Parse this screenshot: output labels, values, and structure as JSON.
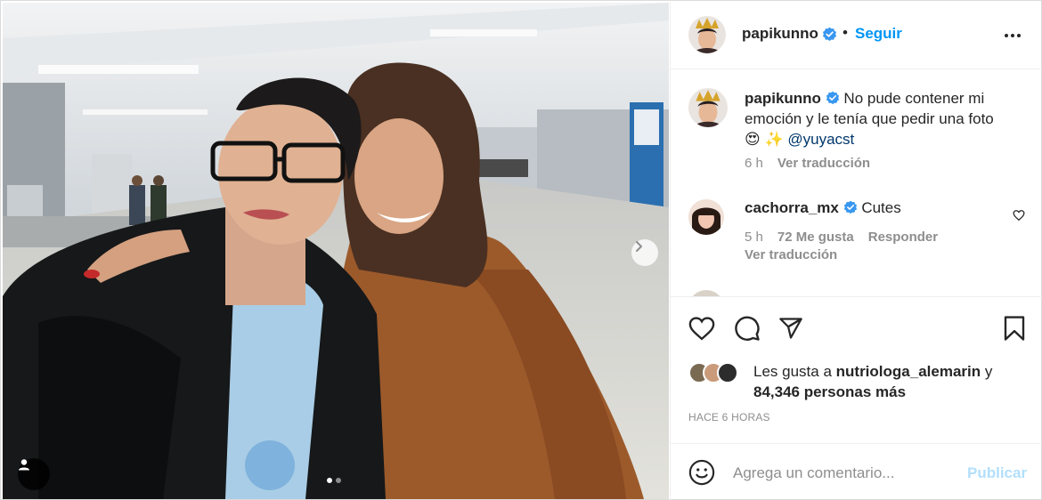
{
  "post": {
    "username": "papikunno",
    "separator": "•",
    "follow_label": "Seguir",
    "more_icon": "more-horizontal-icon",
    "carousel": {
      "current": 1,
      "total": 2
    }
  },
  "caption": {
    "username": "papikunno",
    "text": "No pude contener mi emoción y le tenía que pedir una foto",
    "emojis": "😍 ✨",
    "mention": "@yuyacst",
    "time": "6 h",
    "translate": "Ver traducción"
  },
  "comments": [
    {
      "username": "cachorra_mx",
      "text": "Cutes",
      "time": "5 h",
      "likes": "72 Me gusta",
      "reply": "Responder",
      "translate": "Ver traducción"
    }
  ],
  "likes": {
    "prefix": "Les gusta a",
    "liker": "nutriologa_alemarin",
    "joiner": "y",
    "others": "84,346 personas más"
  },
  "timestamp": "HACE 6 HORAS",
  "comment_box": {
    "placeholder": "Agrega un comentario...",
    "publish_label": "Publicar"
  },
  "colors": {
    "accent": "#0095f6",
    "verified": "#3897f0",
    "muted": "#8e8e8e",
    "publish_disabled": "#b2dffc"
  }
}
